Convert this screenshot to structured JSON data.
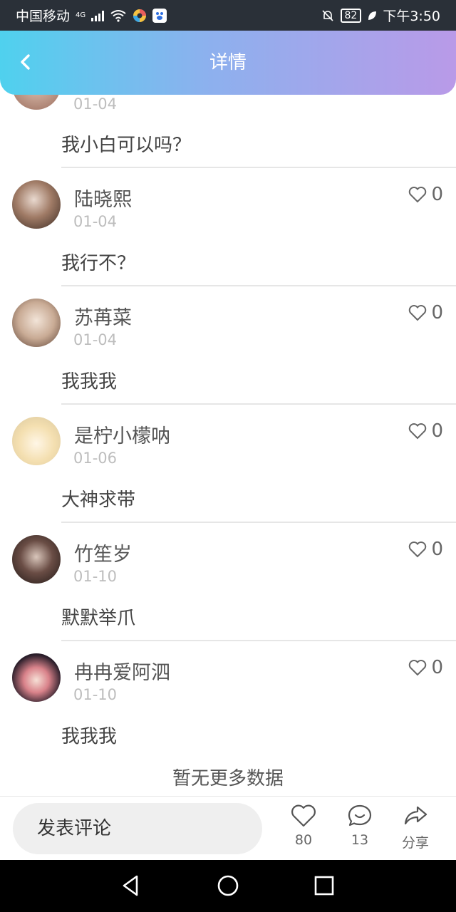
{
  "status_bar": {
    "carrier": "中国移动",
    "network": "4G",
    "battery": "82",
    "time": "下午3:50"
  },
  "header": {
    "title": "详情",
    "back_icon": "chevron-left-icon"
  },
  "comments": [
    {
      "name": "",
      "date": "01-04",
      "text": "我小白可以吗？",
      "likes": "",
      "avatar_color": "#c9a18a"
    },
    {
      "name": "陆晓熙",
      "date": "01-04",
      "text": "我行不？",
      "likes": "0",
      "avatar_color": "#6b4a3a"
    },
    {
      "name": "苏苒菜",
      "date": "01-04",
      "text": "我我我",
      "likes": "0",
      "avatar_color": "#d8c3b0"
    },
    {
      "name": "是柠小檬呐",
      "date": "01-06",
      "text": "大神求带",
      "likes": "0",
      "avatar_color": "#f2e6c8"
    },
    {
      "name": "竹笙岁",
      "date": "01-10",
      "text": "默默举爪",
      "likes": "0",
      "avatar_color": "#3c2f2c"
    },
    {
      "name": "冉冉爱阿泗",
      "date": "01-10",
      "text": "我我我",
      "likes": "0",
      "avatar_color": "#2a1e2a"
    }
  ],
  "list_end": "暂无更多数据",
  "bottom_bar": {
    "input_placeholder": "发表评论",
    "like_count": "80",
    "comment_count": "13",
    "share_label": "分享"
  },
  "colors": {
    "header_gradient_start": "#4fd1ee",
    "header_gradient_end": "#b99ae8"
  }
}
